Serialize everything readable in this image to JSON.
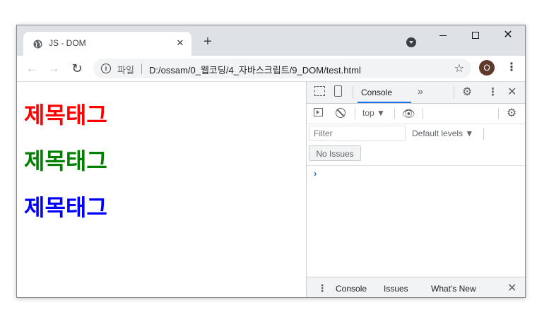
{
  "browser": {
    "tab_title": "JS - DOM",
    "tab_close": "✕",
    "new_tab": "+",
    "url_scheme": "파일",
    "url": "D:/ossam/0_웹코딩/4_자바스크립트/9_DOM/test.html",
    "avatar_letter": "O",
    "window_close": "✕"
  },
  "page": {
    "headings": [
      {
        "text": "제목태그",
        "color": "#ff0000"
      },
      {
        "text": "제목태그",
        "color": "#008000"
      },
      {
        "text": "제목태그",
        "color": "#0000ff"
      }
    ]
  },
  "devtools": {
    "tabs": {
      "console": "Console",
      "more": "»"
    },
    "toolbar": {
      "context": "top ▼"
    },
    "filter_placeholder": "Filter",
    "levels": "Default levels ▼",
    "issues_button": "No Issues",
    "prompt": "›",
    "drawer_tabs": [
      "Console",
      "Issues",
      "What's New"
    ],
    "drawer_close": "✕"
  }
}
